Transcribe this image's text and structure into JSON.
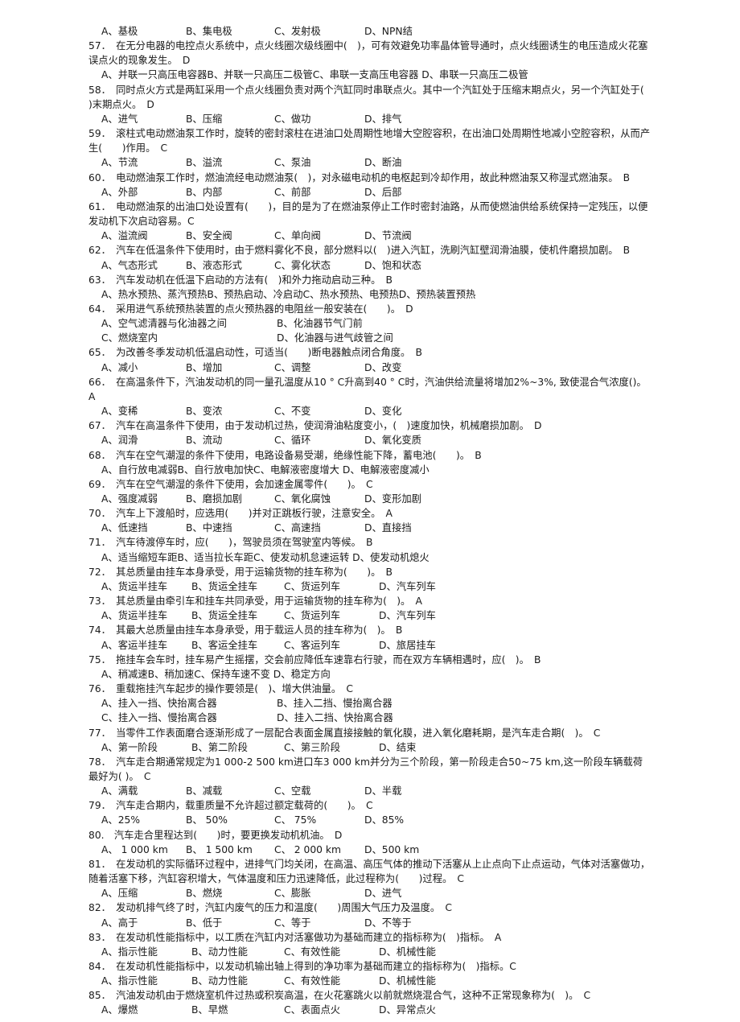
{
  "document": {
    "type": "exam-question-bank",
    "language": "zh-CN",
    "page_number_range": "57-85",
    "lead_options": {
      "label": "leading-option-row",
      "a": "A、基极",
      "b": "B、集电极",
      "c": "C、发射极",
      "d": "D、NPN结"
    }
  },
  "questions": [
    {
      "num": "57．",
      "stem": "在无分电器的电控点火系统中，点火线圈次级线圈中(　)，可有效避免功率晶体管导通时，点火线圈诱生的电压造成火花塞误点火的现象发生。　D",
      "layout": "flow",
      "options_flow": "A、并联一只高压电容器B、并联一只高压二极管C、串联一支高压电容器 D、串联一只高压二极管"
    },
    {
      "num": "58．",
      "stem": "同时点火方式是两缸采用一个点火线圈负责对两个汽缸同时串联点火。其中一个汽缸处于压缩末期点火，另一个汽缸处于(　　)末期点火。　D",
      "layout": "cols4",
      "options": [
        "A、进气",
        "B、压缩",
        "C、做功",
        "D、排气"
      ]
    },
    {
      "num": "59．",
      "stem": "滚柱式电动燃油泵工作时，旋转的密封滚柱在进油口处周期性地增大空腔容积，在出油口处周期性地减小空腔容积，从而产\n生(　　)作用。　C",
      "layout": "cols4",
      "options": [
        "A、节流",
        "B、溢流",
        "C、泵油",
        "D、断油"
      ]
    },
    {
      "num": "60．",
      "stem": "电动燃油泵工作时，燃油流经电动燃油泵(　)，对永磁电动机的电枢起到冷却作用，故此种燃油泵又称湿式燃油泵。　B",
      "layout": "cols4",
      "options": [
        "A、外部",
        "B、内部",
        "C、前部",
        "D、后部"
      ]
    },
    {
      "num": "61．",
      "stem": "电动燃油泵的出油口处设置有(　　)，目的是为了在燃油泵停止工作时密封油路，从而使燃油供给系统保持一定残压，以便发动机下次启动容易。C",
      "layout": "cols4",
      "options": [
        "A、溢流阀",
        "B、安全阀",
        "C、单向阀",
        "D、节流阀"
      ]
    },
    {
      "num": "62．",
      "stem": "汽车在低温条件下使用时，由于燃料雾化不良，部分燃料以(　)进入汽缸，洗刷汽缸壁润滑油膜，使机件磨损加剧。　B",
      "layout": "cols4",
      "options": [
        "A、气态形式",
        "B、液态形式",
        "C、雾化状态",
        "D、饱和状态"
      ]
    },
    {
      "num": "63．",
      "stem": "汽车发动机在低温下启动的方法有(　)和外力拖动启动三种。　B",
      "layout": "flow",
      "options_flow": "A、热水预热、蒸汽预热B、预热启动、冷启动C、热水预热、电预热D、预热装置预热"
    },
    {
      "num": "64．",
      "stem": "采用进气系统预热装置的点火预热器的电阻丝一般安装在(　　)。　D",
      "layout": "cols2",
      "options": [
        "A、空气滤清器与化油器之间",
        "B、化油器节气门前",
        "C、燃烧室内",
        "D、化油器与进气歧管之间"
      ]
    },
    {
      "num": "65．",
      "stem": "为改善冬季发动机低温启动性，可适当(　　)断电器触点闭合角度。　B",
      "layout": "cols4",
      "options": [
        "A、减小",
        "B、增加",
        "C、调整",
        "D、改变"
      ]
    },
    {
      "num": "66．",
      "stem": "在高温条件下，汽油发动机的同一量孔温度从10 ° C升高到40 ° C时，汽油供给流量将增加2%~3%, 致使混合气浓度()。　A",
      "layout": "cols4",
      "options": [
        "A、变稀",
        "B、变浓",
        "C、不变",
        "D、变化"
      ]
    },
    {
      "num": "67．",
      "stem": "汽车在高温条件下使用，由于发动机过热，使润滑油粘度变小，(　)速度加快，机械磨损加剧。　D",
      "layout": "cols4",
      "options": [
        "A、润滑",
        "B、流动",
        "C、循环",
        "D、氧化变质"
      ]
    },
    {
      "num": "68．",
      "stem": "汽车在空气潮湿的条件下使用，电路设备易受潮，绝缘性能下降，蓄电池(　　)。　B",
      "layout": "flow",
      "options_flow": "A、自行放电减弱B、自行放电加快C、电解液密度增大 D、电解液密度减小"
    },
    {
      "num": "69．",
      "stem": "汽车在空气潮湿的条件下使用，会加速金属零件(　　)。　C",
      "layout": "cols4",
      "options": [
        "A、强度减弱",
        "B、磨损加剧",
        "C、氧化腐蚀",
        "D、变形加剧"
      ]
    },
    {
      "num": "70．",
      "stem": "汽车上下渡船时，应选用(　　)并对正跳板行驶，注意安全。　A",
      "layout": "cols4",
      "options": [
        "A、低速挡",
        "B、中速挡",
        "C、高速挡",
        "D、直接挡"
      ]
    },
    {
      "num": "71．",
      "stem": "汽车待渡停车时，应(　　)，驾驶员须在驾驶室内等候。　B",
      "layout": "flow",
      "options_flow": "A、适当缩短车距B、适当拉长车距C、使发动机怠速运转 D、使发动机熄火"
    },
    {
      "num": "72．",
      "stem": "其总质量由挂车本身承受，用于运输货物的挂车称为(　　)。　B",
      "layout": "cols4w",
      "options": [
        "A、货运半挂车",
        "B、货运全挂车",
        "C、货运列车",
        "D、汽车列车"
      ]
    },
    {
      "num": "73．",
      "stem": "其总质量由牵引车和挂车共同承受，用于运输货物的挂车称为(　)。　A",
      "layout": "cols4w",
      "options": [
        "A、货运半挂车",
        "B、货运全挂车",
        "C、货运列车",
        "D、汽车列车"
      ]
    },
    {
      "num": "74．",
      "stem": "其最大总质量由挂车本身承受，用于载运人员的挂车称为(　)。　B",
      "layout": "cols4w",
      "options": [
        "A、客运半挂车",
        "B、客运全挂车",
        "C、客运列车",
        "D、旅居挂车"
      ]
    },
    {
      "num": "75．",
      "stem": "拖挂车会车时，挂车易产生摇摆，交会前应降低车速靠右行驶，而在双方车辆相遇时，应(　)。　B",
      "layout": "flow",
      "options_flow": "A、稍减速B、稍加速C、保持车速不变 D、稳定方向"
    },
    {
      "num": "76．",
      "stem": "重载拖挂汽车起步的操作要领是(　)、增大供油量。　C",
      "layout": "cols2",
      "options": [
        "A、挂入一挡、快抬离合器",
        "B、挂入二挡、慢抬离合器",
        "C、挂入一挡、慢抬离合器",
        "D、挂入二挡、快抬离合器"
      ]
    },
    {
      "num": "77．",
      "stem": "当零件工作表面磨合逐渐形成了一层配合表面金属直接接触的氧化膜，进入氧化磨耗期，是汽车走合期(　)。　C",
      "layout": "cols4w",
      "options": [
        "A、第一阶段",
        "B、第二阶段",
        "C、第三阶段",
        "D、结束"
      ]
    },
    {
      "num": "78．",
      "stem": "汽车走合期通常规定为1 000-2 500 km进口车3 000 km并分为三个阶段，第一阶段走合50~75 km,这一阶段车辆载荷 最好为( )。　C",
      "layout": "cols4",
      "options": [
        "A、满载",
        "B、减载",
        "C、空载",
        "D、半载"
      ]
    },
    {
      "num": "79．",
      "stem": "汽车走合期内，载重质量不允许超过额定载荷的(　　)。　C",
      "layout": "cols4",
      "options": [
        "A、25%",
        "B、 50%",
        "C、 75%",
        "D、85%"
      ]
    },
    {
      "num": "80.",
      "stem": "汽车走合里程达到(　　)时，要更换发动机机油。　D",
      "layout": "cols4",
      "options": [
        "A、 1 000 km",
        "B、 1 500 km",
        "C、 2 000 km",
        "D、500  km"
      ]
    },
    {
      "num": "81．",
      "stem": "在发动机的实际循环过程中，进排气门均关闭，在高温、高压气体的推动下活塞从上止点向下止点运动，气体对活塞做功，\n随着活塞下移，汽缸容积增大，气体温度和压力迅速降低，此过程称为(　　)过程。　C",
      "layout": "cols4",
      "options": [
        "A、压缩",
        "B、燃烧",
        "C、膨胀",
        "D、进气"
      ]
    },
    {
      "num": "82．",
      "stem": "发动机排气终了时，汽缸内废气的压力和温度(　　)周围大气压力及温度。　C",
      "layout": "cols4",
      "options": [
        "A、高于",
        "B、低于",
        "C、等于",
        "D、不等于"
      ]
    },
    {
      "num": "83．",
      "stem": "在发动机性能指标中，以工质在汽缸内对活塞做功为基础而建立的指标称为(　)指标。　A",
      "layout": "cols4w",
      "options": [
        "A、指示性能",
        "B、动力性能",
        "C、有效性能",
        "D、机械性能"
      ]
    },
    {
      "num": "84．",
      "stem": "在发动机性能指标中，以发动机输出轴上得到的净功率为基础而建立的指标称为(　)指标。C",
      "layout": "cols4w",
      "options": [
        "A、指示性能",
        "B、动力性能",
        "C、有效性能",
        "D、机械性能"
      ]
    },
    {
      "num": "85．",
      "stem": "汽油发动机由于燃烧室机件过热或积炭高温，在火花塞跳火以前就燃烧混合气，这种不正常现象称为(　)。　C",
      "layout": "cols4w",
      "options": [
        "A、爆燃",
        "B、早燃",
        "C、表面点火",
        "D、异常点火"
      ]
    }
  ]
}
